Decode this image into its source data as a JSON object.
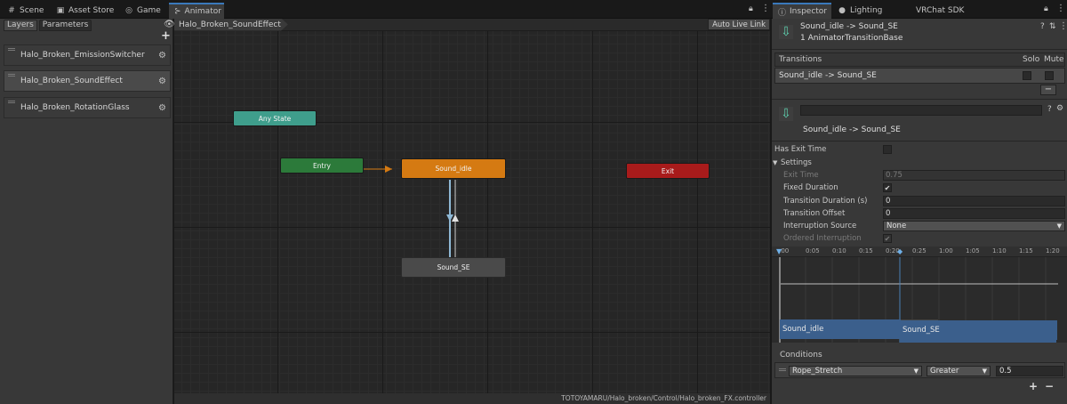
{
  "tabs": {
    "left": [
      {
        "label": "Scene",
        "icon": "grid-icon"
      },
      {
        "label": "Asset Store",
        "icon": "store-icon"
      },
      {
        "label": "Game",
        "icon": "gamepad-icon"
      },
      {
        "label": "Animator",
        "icon": "animator-icon"
      }
    ],
    "right": [
      {
        "label": "Inspector",
        "icon": "info-icon"
      },
      {
        "label": "Lighting",
        "icon": "bulb-icon"
      },
      {
        "label": "VRChat SDK",
        "icon": ""
      }
    ]
  },
  "layers_panel": {
    "subtabs": [
      "Layers",
      "Parameters"
    ],
    "add_symbol": "+",
    "layers": [
      {
        "label": "Halo_Broken_EmissionSwitcher"
      },
      {
        "label": "Halo_Broken_SoundEffect"
      },
      {
        "label": "Halo_Broken_RotationGlass"
      }
    ]
  },
  "graph": {
    "breadcrumb": "Halo_Broken_SoundEffect",
    "auto_live_link": "Auto Live Link",
    "footer_path": "TOTOYAMARU/Halo_broken/Control/Halo_broken_FX.controller",
    "nodes": {
      "any_state": "Any State",
      "entry": "Entry",
      "sound_idle": "Sound_idle",
      "exit": "Exit",
      "sound_se": "Sound_SE"
    },
    "colors": {
      "any_state": "#3f9e8c",
      "entry": "#2c7a3a",
      "default_state": "#d57a12",
      "exit": "#a81b1b",
      "state": "#4a4a4a",
      "transition": "#8fb9d6"
    }
  },
  "inspector": {
    "header_title": "Sound_idle -> Sound_SE",
    "header_subtitle": "1 AnimatorTransitionBase",
    "transitions_label": "Transitions",
    "solo_label": "Solo",
    "mute_label": "Mute",
    "transition_item": "Sound_idle -> Sound_SE",
    "minus": "−",
    "transition_name_value": "",
    "transition_title": "Sound_idle -> Sound_SE",
    "has_exit_time_label": "Has Exit Time",
    "has_exit_time": false,
    "settings_label": "Settings",
    "exit_time_label": "Exit Time",
    "exit_time_value": "0.75",
    "fixed_duration_label": "Fixed Duration",
    "fixed_duration": true,
    "transition_duration_label": "Transition Duration (s)",
    "transition_duration_value": "0",
    "transition_offset_label": "Transition Offset",
    "transition_offset_value": "0",
    "interruption_source_label": "Interruption Source",
    "interruption_source_value": "None",
    "ordered_interruption_label": "Ordered Interruption",
    "ordered_interruption": true,
    "check_mark": "✔",
    "timeline_ticks": [
      ":00",
      "0:05",
      "0:10",
      "0:15",
      "0:20",
      "0:25",
      "1:00",
      "1:05",
      "1:10",
      "1:15",
      "1:20"
    ],
    "timeline_bars": {
      "from": "Sound_idle",
      "to": "Sound_SE"
    },
    "conditions_label": "Conditions",
    "condition": {
      "parameter": "Rope_Stretch",
      "mode": "Greater",
      "value": "0.5"
    },
    "plus": "+",
    "minus2": "−"
  }
}
